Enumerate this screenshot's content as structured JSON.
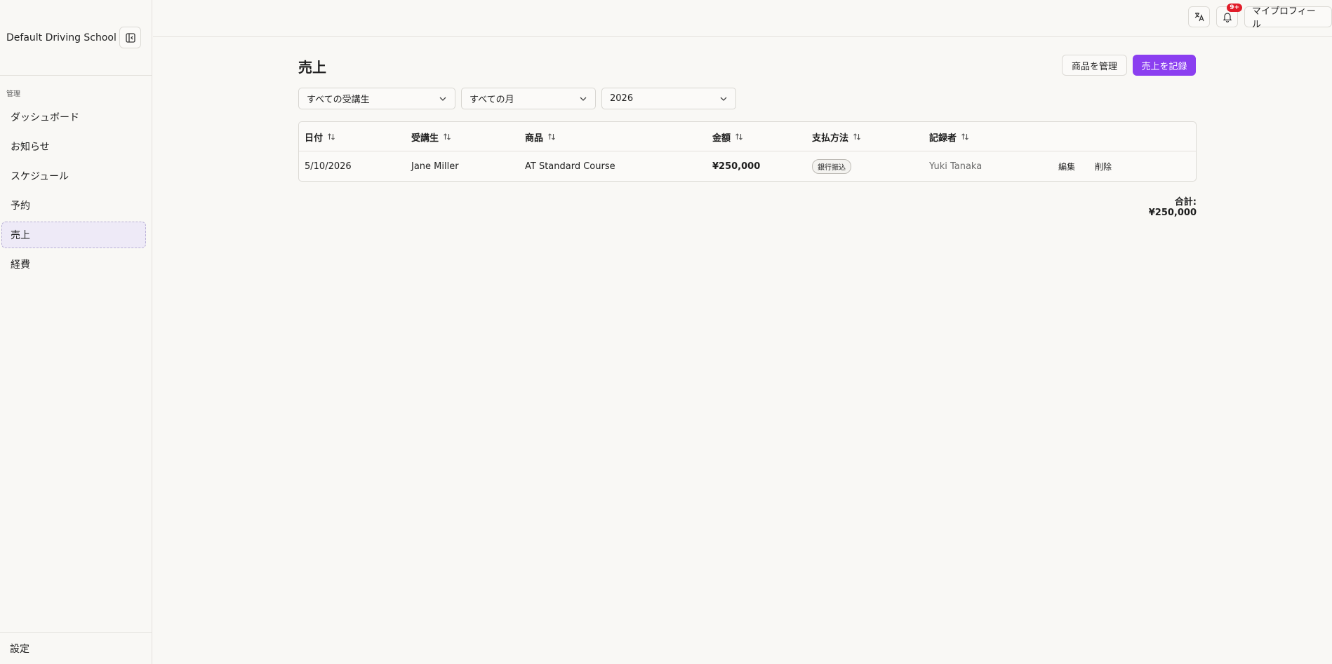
{
  "sidebar": {
    "school_name": "Default Driving School",
    "section_label": "管理",
    "items": [
      {
        "label": "ダッシュボード"
      },
      {
        "label": "お知らせ"
      },
      {
        "label": "スケジュール"
      },
      {
        "label": "予約"
      },
      {
        "label": "売上"
      },
      {
        "label": "経費"
      }
    ],
    "active_item": "売上",
    "settings_label": "設定"
  },
  "topbar": {
    "notification_badge": "9+",
    "profile_label": "マイプロフィール"
  },
  "page": {
    "title": "売上",
    "manage_products_label": "商品を管理",
    "record_sale_label": "売上を記録",
    "accent_color": "#8b3ff0"
  },
  "filters": {
    "student": "すべての受講生",
    "month": "すべての月",
    "year": "2026"
  },
  "table": {
    "columns": [
      "日付",
      "受講生",
      "商品",
      "金額",
      "支払方法",
      "記録者"
    ],
    "rows": [
      {
        "date": "5/10/2026",
        "student": "Jane Miller",
        "product": "AT Standard Course",
        "amount": "¥250,000",
        "payment_method": "銀行振込",
        "recorder": "Yuki Tanaka",
        "edit_label": "編集",
        "delete_label": "削除"
      }
    ]
  },
  "total": "合計: ¥250,000"
}
